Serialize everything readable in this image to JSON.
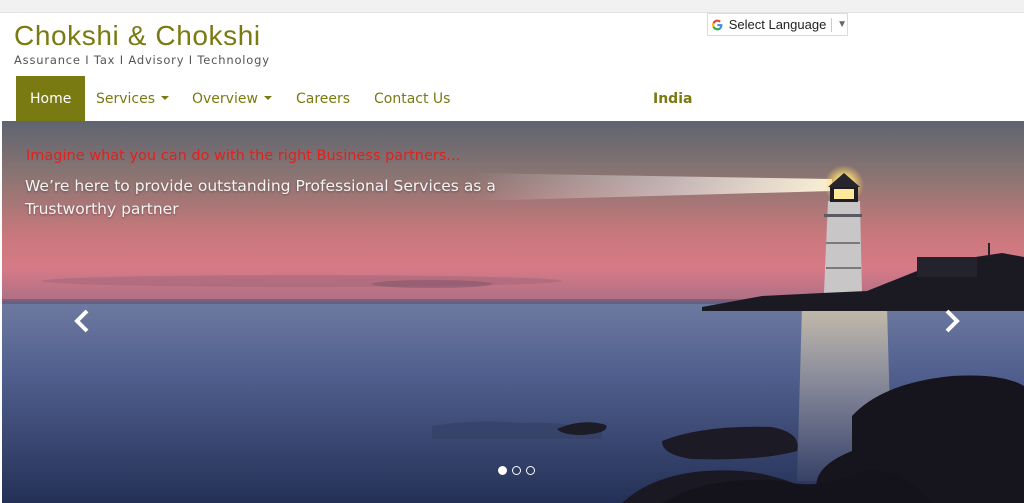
{
  "brand": {
    "name": "Chokshi & Chokshi",
    "tagline": "Assurance I Tax I Advisory I  Technology",
    "color": "#7a7a12"
  },
  "language_widget": {
    "label": "Select Language",
    "icon": "google-g-icon",
    "arrow": "▼"
  },
  "nav": {
    "items": [
      {
        "label": "Home",
        "active": true
      },
      {
        "label": "Services",
        "dropdown": true
      },
      {
        "label": "Overview",
        "dropdown": true
      },
      {
        "label": "Careers"
      },
      {
        "label": "Contact Us"
      }
    ],
    "region": "India"
  },
  "hero": {
    "headline": "Imagine what you can do with the right Business partners...",
    "subtext": "We’re here to provide outstanding Professional Services as a Trustworthy partner",
    "headline_color": "#e0211d",
    "prev_icon": "chevron-left-icon",
    "next_icon": "chevron-right-icon",
    "slides_count": 3,
    "active_slide": 1
  }
}
